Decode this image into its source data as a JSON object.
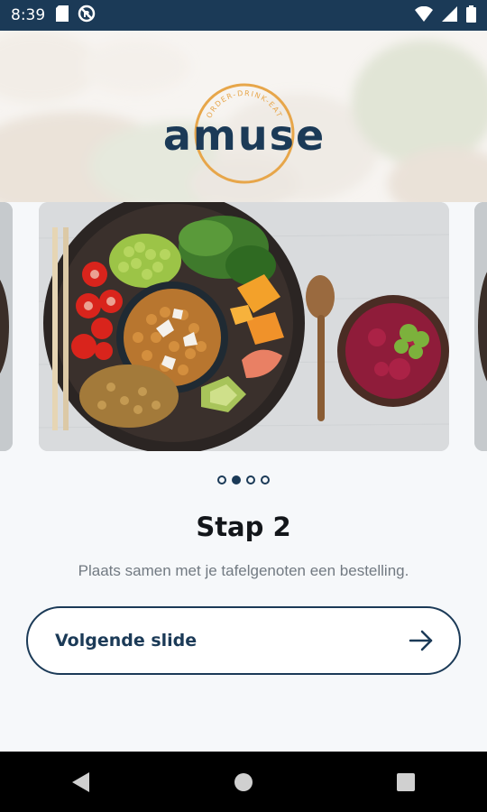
{
  "status_bar": {
    "time": "8:39",
    "left_icons": [
      "sd-card-icon",
      "no-data-icon"
    ],
    "right_icons": [
      "wifi-icon",
      "signal-icon",
      "battery-icon"
    ]
  },
  "header": {
    "logo_text": "amuse",
    "logo_tagline": "ORDER-DRINK-EAT",
    "logo_colors": {
      "text": "#1b3a57",
      "ring": "#e7a64a"
    }
  },
  "carousel": {
    "slides_count": 4,
    "active_index": 1,
    "image_description": "food-bowl-image"
  },
  "content": {
    "step_title": "Stap 2",
    "description": "Plaats samen met je tafelgenoten een bestelling."
  },
  "button": {
    "label": "Volgende slide",
    "icon": "arrow-right-icon"
  },
  "nav_bar": {
    "buttons": [
      "back-icon",
      "home-icon",
      "recents-icon"
    ]
  },
  "colors": {
    "primary": "#1b3a57",
    "accent": "#e7a64a",
    "background": "#f6f8fa"
  }
}
